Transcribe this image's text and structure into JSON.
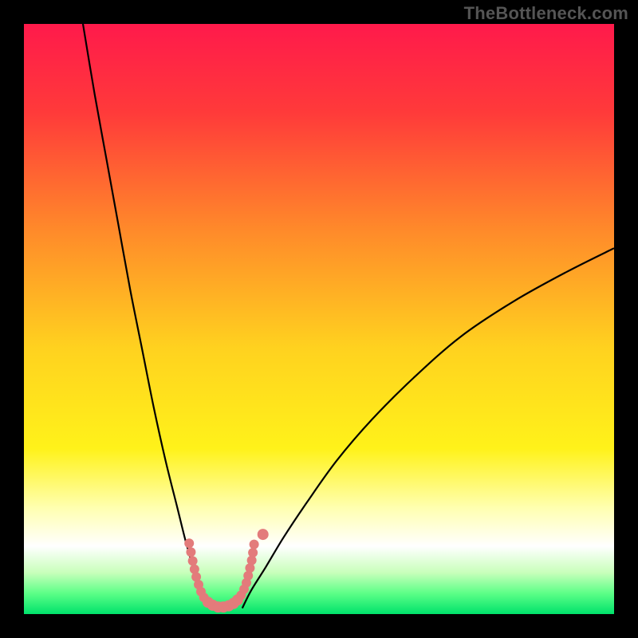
{
  "watermark": "TheBottleneck.com",
  "chart_data": {
    "type": "line",
    "title": "",
    "xlabel": "",
    "ylabel": "",
    "xlim": [
      0,
      100
    ],
    "ylim": [
      0,
      100
    ],
    "gradient_stops": [
      {
        "offset": 0.0,
        "color": "#ff1a4b"
      },
      {
        "offset": 0.15,
        "color": "#ff3a3a"
      },
      {
        "offset": 0.35,
        "color": "#ff8a2a"
      },
      {
        "offset": 0.55,
        "color": "#ffd21f"
      },
      {
        "offset": 0.72,
        "color": "#fff21a"
      },
      {
        "offset": 0.82,
        "color": "#ffffb0"
      },
      {
        "offset": 0.885,
        "color": "#ffffff"
      },
      {
        "offset": 0.93,
        "color": "#c8ffba"
      },
      {
        "offset": 0.965,
        "color": "#5cff87"
      },
      {
        "offset": 1.0,
        "color": "#00e26b"
      }
    ],
    "series": [
      {
        "name": "left-branch",
        "x": [
          10,
          12,
          14,
          16,
          18,
          20,
          22,
          24,
          26,
          27.5,
          29,
          30.5,
          31.5
        ],
        "y": [
          100,
          88,
          77,
          66,
          55,
          45,
          35,
          26,
          18,
          12,
          7,
          3,
          1
        ]
      },
      {
        "name": "right-branch",
        "x": [
          37,
          38.5,
          41,
          44,
          48,
          53,
          59,
          66,
          74,
          83,
          92,
          100
        ],
        "y": [
          1,
          4,
          8,
          13,
          19,
          26,
          33,
          40,
          47,
          53,
          58,
          62
        ]
      }
    ],
    "markers": {
      "name": "bottom-dots",
      "color": "#e37b7b",
      "points": [
        {
          "x": 28.0,
          "y": 12.0,
          "r": 6
        },
        {
          "x": 28.3,
          "y": 10.5,
          "r": 6
        },
        {
          "x": 28.6,
          "y": 9.0,
          "r": 6
        },
        {
          "x": 28.9,
          "y": 7.6,
          "r": 6
        },
        {
          "x": 29.2,
          "y": 6.3,
          "r": 6
        },
        {
          "x": 29.6,
          "y": 5.0,
          "r": 6
        },
        {
          "x": 30.0,
          "y": 3.8,
          "r": 6
        },
        {
          "x": 30.5,
          "y": 2.8,
          "r": 6
        },
        {
          "x": 31.2,
          "y": 2.0,
          "r": 7
        },
        {
          "x": 32.0,
          "y": 1.5,
          "r": 7
        },
        {
          "x": 32.9,
          "y": 1.2,
          "r": 7
        },
        {
          "x": 33.8,
          "y": 1.2,
          "r": 7
        },
        {
          "x": 34.7,
          "y": 1.4,
          "r": 7
        },
        {
          "x": 35.5,
          "y": 1.8,
          "r": 7
        },
        {
          "x": 36.2,
          "y": 2.4,
          "r": 7
        },
        {
          "x": 36.8,
          "y": 3.2,
          "r": 6
        },
        {
          "x": 37.3,
          "y": 4.2,
          "r": 6
        },
        {
          "x": 37.7,
          "y": 5.3,
          "r": 6
        },
        {
          "x": 38.0,
          "y": 6.5,
          "r": 6
        },
        {
          "x": 38.3,
          "y": 7.8,
          "r": 6
        },
        {
          "x": 38.6,
          "y": 9.1,
          "r": 6
        },
        {
          "x": 38.8,
          "y": 10.4,
          "r": 6
        },
        {
          "x": 39.0,
          "y": 11.8,
          "r": 6
        },
        {
          "x": 40.5,
          "y": 13.5,
          "r": 7
        }
      ]
    }
  }
}
